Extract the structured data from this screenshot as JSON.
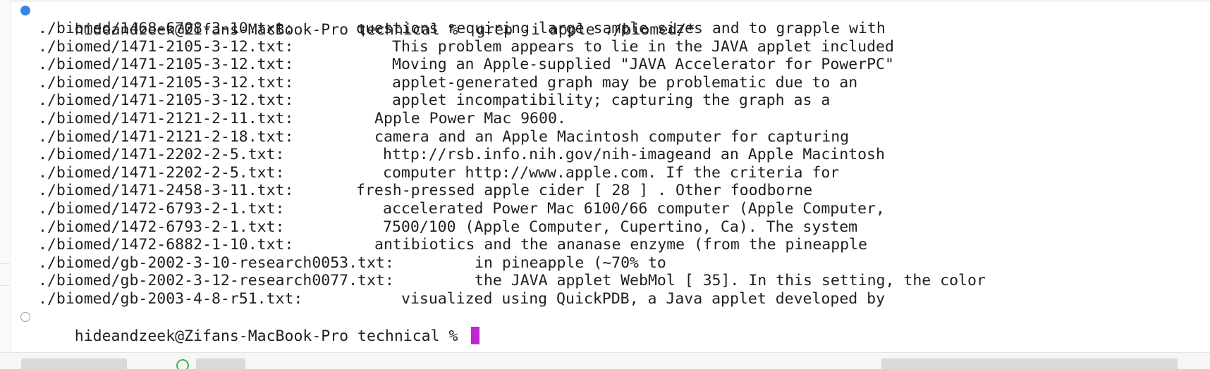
{
  "terminal": {
    "command_prompt": "hideandzeek@Zifans-MacBook-Pro technical %  grep -i apple ./biomed/*",
    "results": [
      {
        "file": "./biomed/1468-6708-3-10.txt:",
        "text": "questions requiring large sample sizes and to grapple with"
      },
      {
        "file": "./biomed/1471-2105-3-12.txt:",
        "text": "This problem appears to lie in the JAVA applet included"
      },
      {
        "file": "./biomed/1471-2105-3-12.txt:",
        "text": "Moving an Apple-supplied \"JAVA Accelerator for PowerPC\""
      },
      {
        "file": "./biomed/1471-2105-3-12.txt:",
        "text": "applet-generated graph may be problematic due to an"
      },
      {
        "file": "./biomed/1471-2105-3-12.txt:",
        "text": "applet incompatibility; capturing the graph as a"
      },
      {
        "file": "./biomed/1471-2121-2-11.txt:",
        "text": "Apple Power Mac 9600."
      },
      {
        "file": "./biomed/1471-2121-2-18.txt:",
        "text": "camera and an Apple Macintosh computer for capturing"
      },
      {
        "file": "./biomed/1471-2202-2-5.txt:",
        "text": "http://rsb.info.nih.gov/nih-imageand an Apple Macintosh"
      },
      {
        "file": "./biomed/1471-2202-2-5.txt:",
        "text": "computer http://www.apple.com. If the criteria for"
      },
      {
        "file": "./biomed/1471-2458-3-11.txt:",
        "text": "fresh-pressed apple cider [ 28 ] . Other foodborne"
      },
      {
        "file": "./biomed/1472-6793-2-1.txt:",
        "text": "accelerated Power Mac 6100/66 computer (Apple Computer,"
      },
      {
        "file": "./biomed/1472-6793-2-1.txt:",
        "text": "7500/100 (Apple Computer, Cupertino, Ca). The system"
      },
      {
        "file": "./biomed/1472-6882-1-10.txt:",
        "text": "antibiotics and the ananase enzyme (from the pineapple"
      },
      {
        "file": "./biomed/gb-2002-3-10-research0053.txt:",
        "text": "in pineapple (~70% to"
      },
      {
        "file": "./biomed/gb-2002-3-12-research0077.txt:",
        "text": "the JAVA applet WebMol [ 35]. In this setting, the color"
      },
      {
        "file": "./biomed/gb-2003-4-8-r51.txt:",
        "text": "visualized using QuickPDB, a Java applet developed by"
      }
    ],
    "current_prompt": "hideandzeek@Zifans-MacBook-Pro technical % "
  },
  "colors": {
    "previous_command_mark": "#3b82e8",
    "current_command_mark": "#9a9a9a",
    "cursor": "#c026d3",
    "text": "#1f1f1f"
  },
  "icons": {
    "previous_command_mark": "filled-circle-mark-icon",
    "current_command_mark": "hollow-circle-mark-icon"
  }
}
